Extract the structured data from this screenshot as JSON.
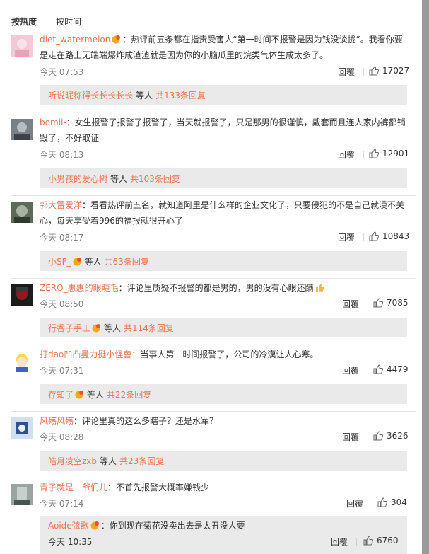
{
  "sort_tabs": {
    "hot": "按热度",
    "time": "按时间"
  },
  "labels": {
    "reply": "回覆",
    "replies_suffix_1": "等人",
    "replies_suffix_2": "回复"
  },
  "comments": [
    {
      "user": "diet_watermelon",
      "text": "：热评前五条都在指责受害人“第一时间不报警是因为钱没谈拢”。我看你要是走在路上无端端爆炸成渣渣就是因为你的小脑瓜里的烷类气体生成太多了。",
      "time": "今天 07:53",
      "likes": "17027",
      "sub_user": "听说昵称得长长长长长",
      "sub_count": "共133条回复"
    },
    {
      "user": "bomii-",
      "text": "：女生报警了报警了报警了，当天就报警了，只是那男的很谨慎，戴套而且连人家内裤都销毁了，不好取证",
      "time": "今天 08:13",
      "likes": "12901",
      "sub_user": "小男孩的爱心树",
      "sub_count": "共103条回复"
    },
    {
      "user": "郭大雷爱洋",
      "text": "：看看热评前五名，就知道阿里是什么样的企业文化了，只要侵犯的不是自己就漠不关心，每天享受着996的福报就很开心了",
      "time": "今天 08:17",
      "likes": "10843",
      "sub_user": "小SF_",
      "sub_count": "共63条回复"
    },
    {
      "user": "ZERO_惠惠的眼睫毛",
      "text": "：评论里质疑不报警的都是男的，男的没有心眼还蹒",
      "time": "今天 08:50",
      "likes": "7085",
      "sub_user": "行香子手工",
      "sub_count": "共114条回复"
    },
    {
      "user": "打dao凹凸曼力挺小怪兽",
      "text": "：当事人第一时间报警了，公司的冷漠让人心寒。",
      "time": "今天 07:31",
      "likes": "4479",
      "sub_user": "存知了",
      "sub_count": "共22条回复"
    },
    {
      "user": "风殇风殇",
      "text": "：评论里真的这么多瞎子？还是水军？",
      "time": "今天 08:28",
      "likes": "3626",
      "sub_user": "皓月凌空zxb",
      "sub_count": "共23条回复"
    },
    {
      "user": "青子就是一爷们儿",
      "text": "：不首先报警大概率嫌钱少",
      "time": "今天 07:14",
      "likes": "304",
      "sub_user": "Aoide弦歌",
      "sub_text": "：你到现在菊花没卖出去是太丑没人要",
      "sub_time": "今天 10:35",
      "sub_likes": "6760"
    }
  ],
  "colors": {
    "username": "#eb7350",
    "subbox_bg": "#eaeaea",
    "text": "#333333",
    "meta": "#808080"
  }
}
